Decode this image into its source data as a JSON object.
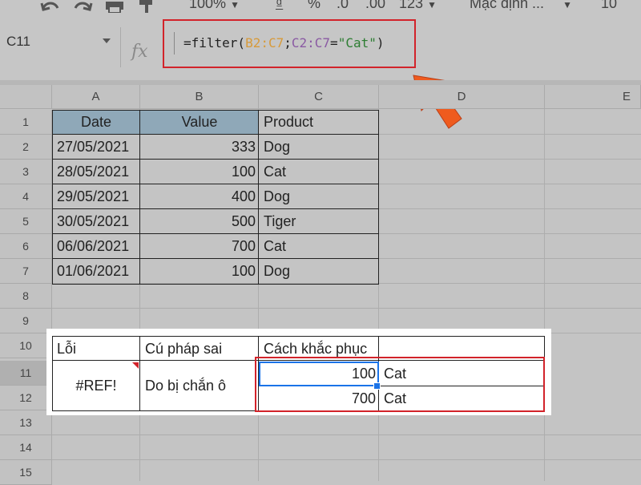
{
  "toolbar": {
    "zoom": "100%",
    "currency": "₫",
    "percent": "%",
    "dec_decrease": ".0",
    "dec_increase": ".00",
    "number_format": "123",
    "font": "Mặc định ...",
    "font_size": "10"
  },
  "namebox": {
    "ref": "C11"
  },
  "formula": {
    "fx": "fx",
    "p1": "=filter(",
    "p2": "B2:C7",
    "p3": ";",
    "p4": "C2:C7",
    "p5": "=",
    "p6": "\"Cat\"",
    "p7": ")"
  },
  "columns": [
    "A",
    "B",
    "C",
    "D",
    "E"
  ],
  "rows": [
    "1",
    "2",
    "3",
    "4",
    "5",
    "6",
    "7",
    "8",
    "9",
    "10",
    "11",
    "12",
    "13",
    "14",
    "15"
  ],
  "table": {
    "headers": [
      "Date",
      "Value",
      "Product"
    ],
    "rows": [
      [
        "27/05/2021",
        "333",
        "Dog"
      ],
      [
        "28/05/2021",
        "100",
        "Cat"
      ],
      [
        "29/05/2021",
        "400",
        "Dog"
      ],
      [
        "30/05/2021",
        "500",
        "Tiger"
      ],
      [
        "06/06/2021",
        "700",
        "Cat"
      ],
      [
        "01/06/2021",
        "100",
        "Dog"
      ]
    ]
  },
  "error_table": {
    "h_error": "Lỗi",
    "h_syntax": "Cú pháp sai",
    "h_fix": "Cách khắc phục",
    "error": "#REF!",
    "syntax": "Do bị chắn ô",
    "results": [
      [
        "100",
        "Cat"
      ],
      [
        "700",
        "Cat"
      ]
    ]
  },
  "colors": {
    "accent_red": "#d2232a",
    "arrow": "#ef5b1e",
    "selection": "#1a73e8",
    "header_fill": "#8fa8b8"
  }
}
